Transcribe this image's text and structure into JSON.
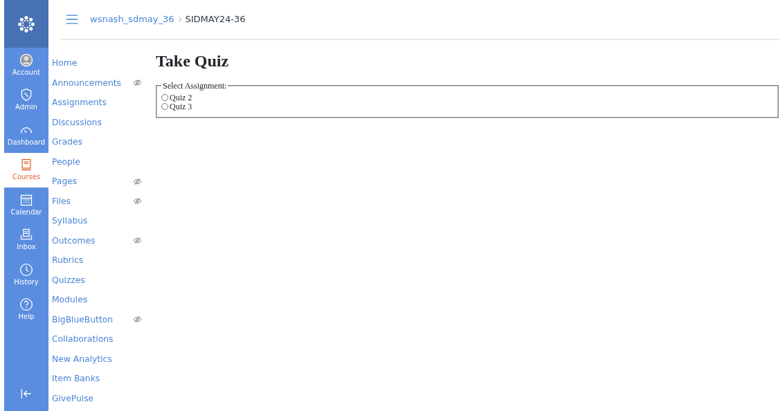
{
  "global_nav": [
    {
      "label": "Account",
      "kind": "account",
      "selected": false
    },
    {
      "label": "Admin",
      "kind": "admin",
      "selected": false
    },
    {
      "label": "Dashboard",
      "kind": "dashboard",
      "selected": false
    },
    {
      "label": "Courses",
      "kind": "courses",
      "selected": true
    },
    {
      "label": "Calendar",
      "kind": "calendar",
      "selected": false
    },
    {
      "label": "Inbox",
      "kind": "inbox",
      "selected": false
    },
    {
      "label": "History",
      "kind": "history",
      "selected": false
    },
    {
      "label": "Help",
      "kind": "help",
      "selected": false
    }
  ],
  "breadcrumb": [
    "wsnash_sdmay_36",
    "SIDMAY24-36"
  ],
  "course_nav": [
    {
      "label": "Home",
      "hidden": false
    },
    {
      "label": "Announcements",
      "hidden": true
    },
    {
      "label": "Assignments",
      "hidden": false
    },
    {
      "label": "Discussions",
      "hidden": false
    },
    {
      "label": "Grades",
      "hidden": false
    },
    {
      "label": "People",
      "hidden": false
    },
    {
      "label": "Pages",
      "hidden": true
    },
    {
      "label": "Files",
      "hidden": true
    },
    {
      "label": "Syllabus",
      "hidden": false
    },
    {
      "label": "Outcomes",
      "hidden": true
    },
    {
      "label": "Rubrics",
      "hidden": false
    },
    {
      "label": "Quizzes",
      "hidden": false
    },
    {
      "label": "Modules",
      "hidden": false
    },
    {
      "label": "BigBlueButton",
      "hidden": true
    },
    {
      "label": "Collaborations",
      "hidden": false
    },
    {
      "label": "New Analytics",
      "hidden": false
    },
    {
      "label": "Item Banks",
      "hidden": false
    },
    {
      "label": "GivePulse",
      "hidden": false
    }
  ],
  "page_title": "Take Quiz",
  "assignment_select": {
    "legend": "Select Assignment:",
    "options": [
      {
        "label": "Quiz 2",
        "selected": false
      },
      {
        "label": "Quiz 3",
        "selected": false
      }
    ]
  }
}
